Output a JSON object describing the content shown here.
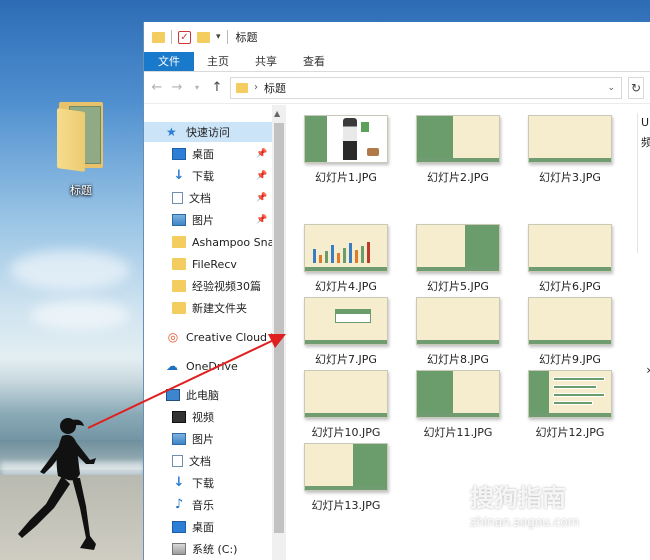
{
  "desktop": {
    "folder_label": "标题"
  },
  "titlebar": {
    "title": "标题"
  },
  "ribbon": {
    "tabs": [
      "文件",
      "主页",
      "共享",
      "查看"
    ]
  },
  "address": {
    "crumb": "标题"
  },
  "nav": {
    "quick_access": "快速访问",
    "items": [
      "桌面",
      "下载",
      "文档",
      "图片",
      "Ashampoo Sna",
      "FileRecv",
      "经验视频30篇",
      "新建文件夹",
      "Creative Cloud F",
      "OneDrive",
      "此电脑",
      "视频",
      "图片",
      "文档",
      "下载",
      "音乐",
      "桌面",
      "系统 (C:)"
    ]
  },
  "files": [
    "幻灯片1.JPG",
    "幻灯片2.JPG",
    "幻灯片3.JPG",
    "幻灯片4.JPG",
    "幻灯片5.JPG",
    "幻灯片6.JPG",
    "幻灯片7.JPG",
    "幻灯片8.JPG",
    "幻灯片9.JPG",
    "幻灯片10.JPG",
    "幻灯片11.JPG",
    "幻灯片12.JPG",
    "幻灯片13.JPG"
  ],
  "detail_pane": [
    "U",
    "频"
  ],
  "watermark": {
    "brand": "搜狗指南",
    "url": "zhinan.sogou.com"
  }
}
